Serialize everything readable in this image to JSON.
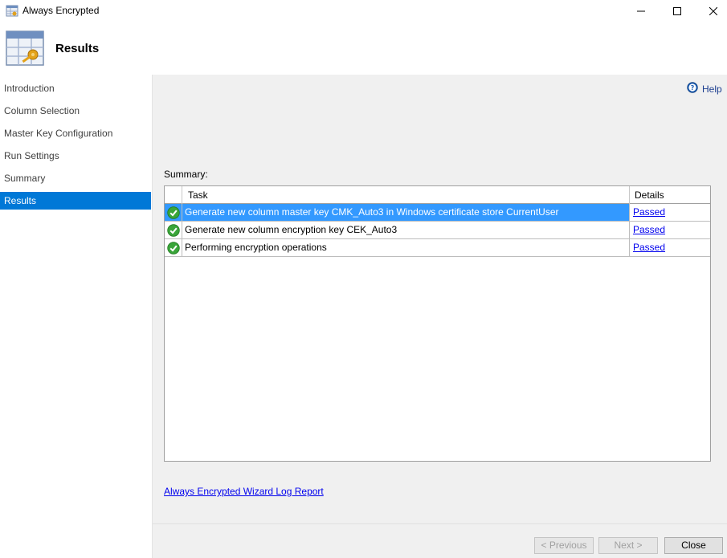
{
  "window": {
    "title": "Always Encrypted",
    "icon": "table-key-icon"
  },
  "header": {
    "title": "Results",
    "icon": "table-key-large-icon"
  },
  "sidebar": {
    "items": [
      {
        "label": "Introduction",
        "active": false
      },
      {
        "label": "Column Selection",
        "active": false
      },
      {
        "label": "Master Key Configuration",
        "active": false
      },
      {
        "label": "Run Settings",
        "active": false
      },
      {
        "label": "Summary",
        "active": false
      },
      {
        "label": "Results",
        "active": true
      }
    ]
  },
  "help": {
    "label": "Help",
    "icon": "help-icon"
  },
  "summary": {
    "label": "Summary:",
    "columns": {
      "task": "Task",
      "details": "Details"
    },
    "rows": [
      {
        "status": "success",
        "task": "Generate new column master key CMK_Auto3 in Windows certificate store CurrentUser",
        "details": "Passed",
        "selected": true
      },
      {
        "status": "success",
        "task": "Generate new column encryption key CEK_Auto3",
        "details": "Passed",
        "selected": false
      },
      {
        "status": "success",
        "task": "Performing encryption operations",
        "details": "Passed",
        "selected": false
      }
    ]
  },
  "log_link": "Always Encrypted Wizard Log Report",
  "buttons": {
    "previous": "< Previous",
    "next": "Next >",
    "close": "Close"
  },
  "colors": {
    "accent": "#0078d7",
    "selection": "#3399ff",
    "link": "#0000ee",
    "success": "#3aa53a"
  }
}
